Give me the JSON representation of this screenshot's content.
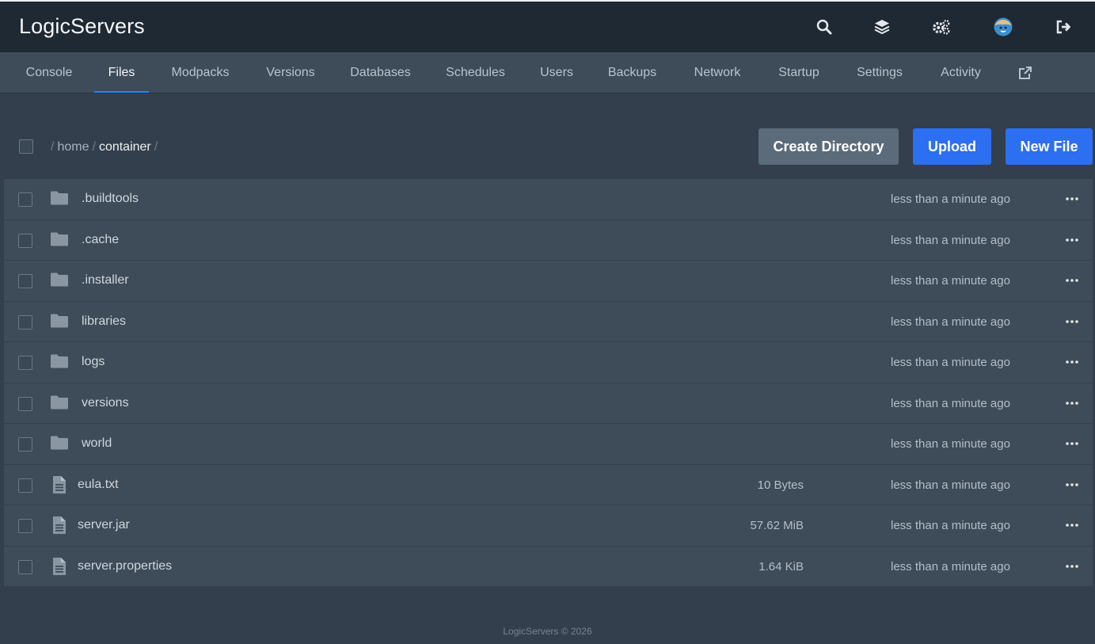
{
  "brand": "LogicServers",
  "header_icons": [
    "search-icon",
    "layers-icon",
    "cogs-icon",
    "avatar",
    "sign-out-icon"
  ],
  "tabs": [
    {
      "label": "Console"
    },
    {
      "label": "Files",
      "active": true
    },
    {
      "label": "Modpacks"
    },
    {
      "label": "Versions"
    },
    {
      "label": "Databases"
    },
    {
      "label": "Schedules"
    },
    {
      "label": "Users"
    },
    {
      "label": "Backups"
    },
    {
      "label": "Network"
    },
    {
      "label": "Startup"
    },
    {
      "label": "Settings"
    },
    {
      "label": "Activity"
    }
  ],
  "breadcrumb": {
    "sep": "/",
    "home": "home",
    "current": "container"
  },
  "actions": {
    "create_directory": "Create Directory",
    "upload": "Upload",
    "new_file": "New File"
  },
  "files": [
    {
      "name": ".buildtools",
      "type": "folder",
      "size": "",
      "modified": "less than a minute ago"
    },
    {
      "name": ".cache",
      "type": "folder",
      "size": "",
      "modified": "less than a minute ago"
    },
    {
      "name": ".installer",
      "type": "folder",
      "size": "",
      "modified": "less than a minute ago"
    },
    {
      "name": "libraries",
      "type": "folder",
      "size": "",
      "modified": "less than a minute ago"
    },
    {
      "name": "logs",
      "type": "folder",
      "size": "",
      "modified": "less than a minute ago"
    },
    {
      "name": "versions",
      "type": "folder",
      "size": "",
      "modified": "less than a minute ago"
    },
    {
      "name": "world",
      "type": "folder",
      "size": "",
      "modified": "less than a minute ago"
    },
    {
      "name": "eula.txt",
      "type": "file",
      "size": "10 Bytes",
      "modified": "less than a minute ago"
    },
    {
      "name": "server.jar",
      "type": "file",
      "size": "57.62 MiB",
      "modified": "less than a minute ago"
    },
    {
      "name": "server.properties",
      "type": "file",
      "size": "1.64 KiB",
      "modified": "less than a minute ago"
    }
  ],
  "footer": "LogicServers © 2026",
  "colors": {
    "accent": "#2c6ff0",
    "header_bg": "#1f2933",
    "nav_bg": "#3e4c59",
    "page_bg": "#333f4d",
    "row_bg": "#3e4c59"
  }
}
